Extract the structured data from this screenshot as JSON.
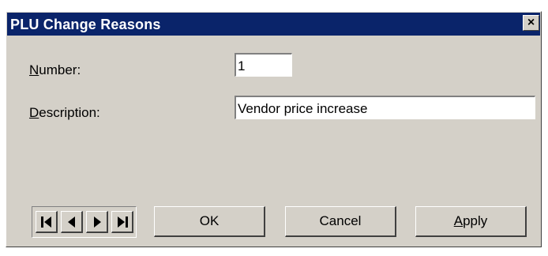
{
  "window": {
    "title": "PLU Change Reasons",
    "close_glyph": "×"
  },
  "form": {
    "number": {
      "label_mnemonic": "N",
      "label_rest": "umber:",
      "value": "1"
    },
    "description": {
      "label_mnemonic": "D",
      "label_rest": "escription:",
      "value": "Vendor price increase"
    }
  },
  "nav": {
    "icons": [
      "first-record-icon",
      "previous-record-icon",
      "next-record-icon",
      "last-record-icon"
    ]
  },
  "buttons": {
    "ok_label": "OK",
    "cancel_label": "Cancel",
    "apply_mnemonic": "A",
    "apply_rest": "pply"
  },
  "colors": {
    "title_bar": "#0a246a",
    "dialog_face": "#d4d0c8"
  }
}
